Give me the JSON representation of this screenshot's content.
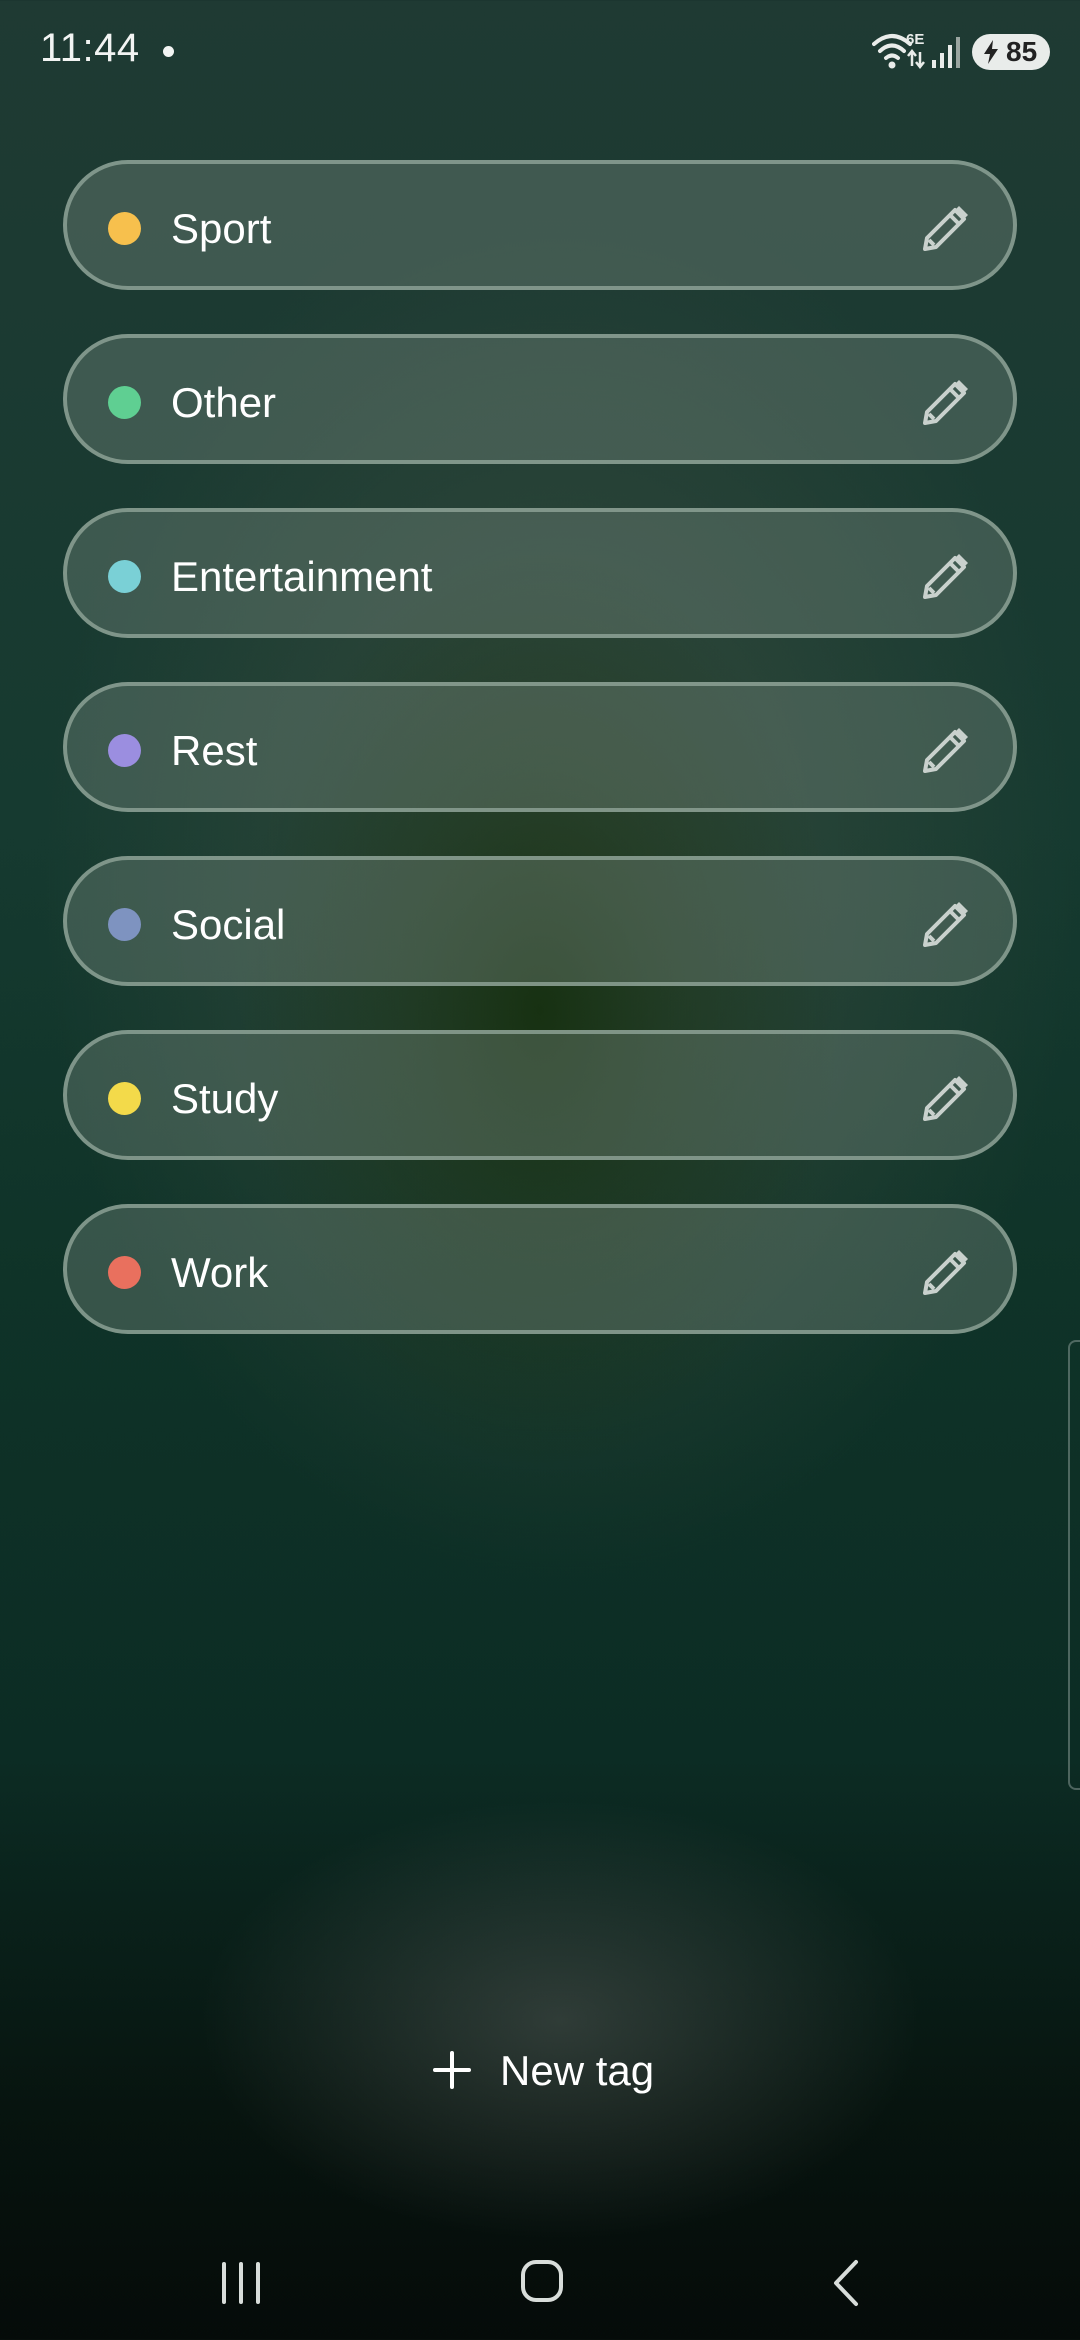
{
  "status_bar": {
    "time": "11:44",
    "network_label": "6E",
    "battery": "85"
  },
  "tags": [
    {
      "label": "Sport",
      "color": "#f7c04d"
    },
    {
      "label": "Other",
      "color": "#5fcf92"
    },
    {
      "label": "Entertainment",
      "color": "#7ad0d6"
    },
    {
      "label": "Rest",
      "color": "#9b8ee0"
    },
    {
      "label": "Social",
      "color": "#7e93c0"
    },
    {
      "label": "Study",
      "color": "#f3da4a"
    },
    {
      "label": "Work",
      "color": "#e9705e"
    }
  ],
  "new_tag": {
    "label": "New tag",
    "icon": "plus-icon"
  },
  "icons": {
    "edit": "pencil-icon",
    "wifi": "wifi-icon",
    "signal": "signal-icon",
    "nav_recents": "recents-icon",
    "nav_home": "home-icon",
    "nav_back": "back-icon"
  }
}
